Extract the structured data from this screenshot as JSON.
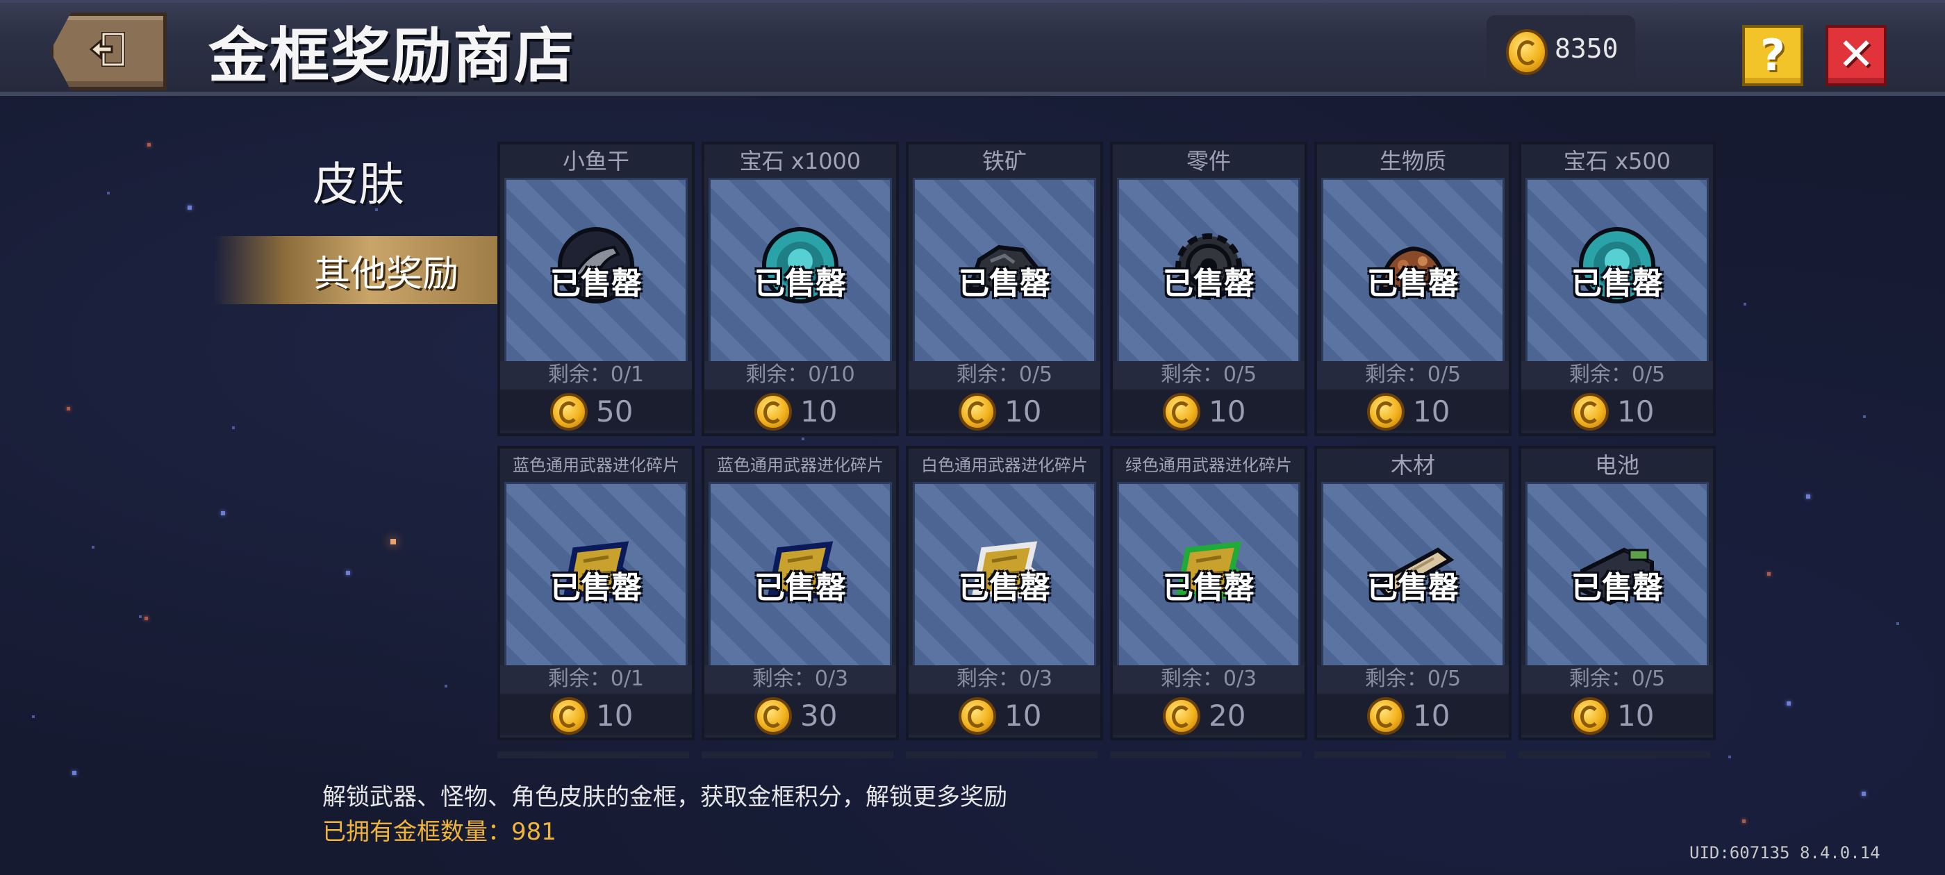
{
  "header": {
    "title": "金框奖励商店",
    "coins": "8350"
  },
  "tabs": {
    "skin": "皮肤",
    "other": "其他奖励"
  },
  "sold_label": "已售罄",
  "items": [
    {
      "name": "小鱼干",
      "remain": "剩余：0/1",
      "price": "50",
      "icon": "dried-fish-icon"
    },
    {
      "name": "宝石 x1000",
      "remain": "剩余：0/10",
      "price": "10",
      "icon": "gem-icon"
    },
    {
      "name": "铁矿",
      "remain": "剩余：0/5",
      "price": "10",
      "icon": "iron-ore-icon"
    },
    {
      "name": "零件",
      "remain": "剩余：0/5",
      "price": "10",
      "icon": "gear-part-icon"
    },
    {
      "name": "生物质",
      "remain": "剩余：0/5",
      "price": "10",
      "icon": "biomass-icon"
    },
    {
      "name": "宝石 x500",
      "remain": "剩余：0/5",
      "price": "10",
      "icon": "gem-icon"
    },
    {
      "name": "蓝色通用武器进化碎片",
      "remain": "剩余：0/1",
      "price": "10",
      "icon": "weapon-shard-icon"
    },
    {
      "name": "蓝色通用武器进化碎片",
      "remain": "剩余：0/3",
      "price": "30",
      "icon": "weapon-shard-icon"
    },
    {
      "name": "白色通用武器进化碎片",
      "remain": "剩余：0/3",
      "price": "10",
      "icon": "weapon-shard-icon"
    },
    {
      "name": "绿色通用武器进化碎片",
      "remain": "剩余：0/3",
      "price": "20",
      "icon": "weapon-shard-icon"
    },
    {
      "name": "木材",
      "remain": "剩余：0/5",
      "price": "10",
      "icon": "wood-icon"
    },
    {
      "name": "电池",
      "remain": "剩余：0/5",
      "price": "10",
      "icon": "battery-icon"
    }
  ],
  "footer": {
    "description": "解锁武器、怪物、角色皮肤的金框，获取金框积分，解锁更多奖励",
    "owned": "已拥有金框数量：981",
    "uid": "UID:607135 8.4.0.14"
  },
  "colors": {
    "accent_gold": "#f0b43a",
    "close_red": "#e0343a",
    "help_yellow": "#f3c42a"
  }
}
